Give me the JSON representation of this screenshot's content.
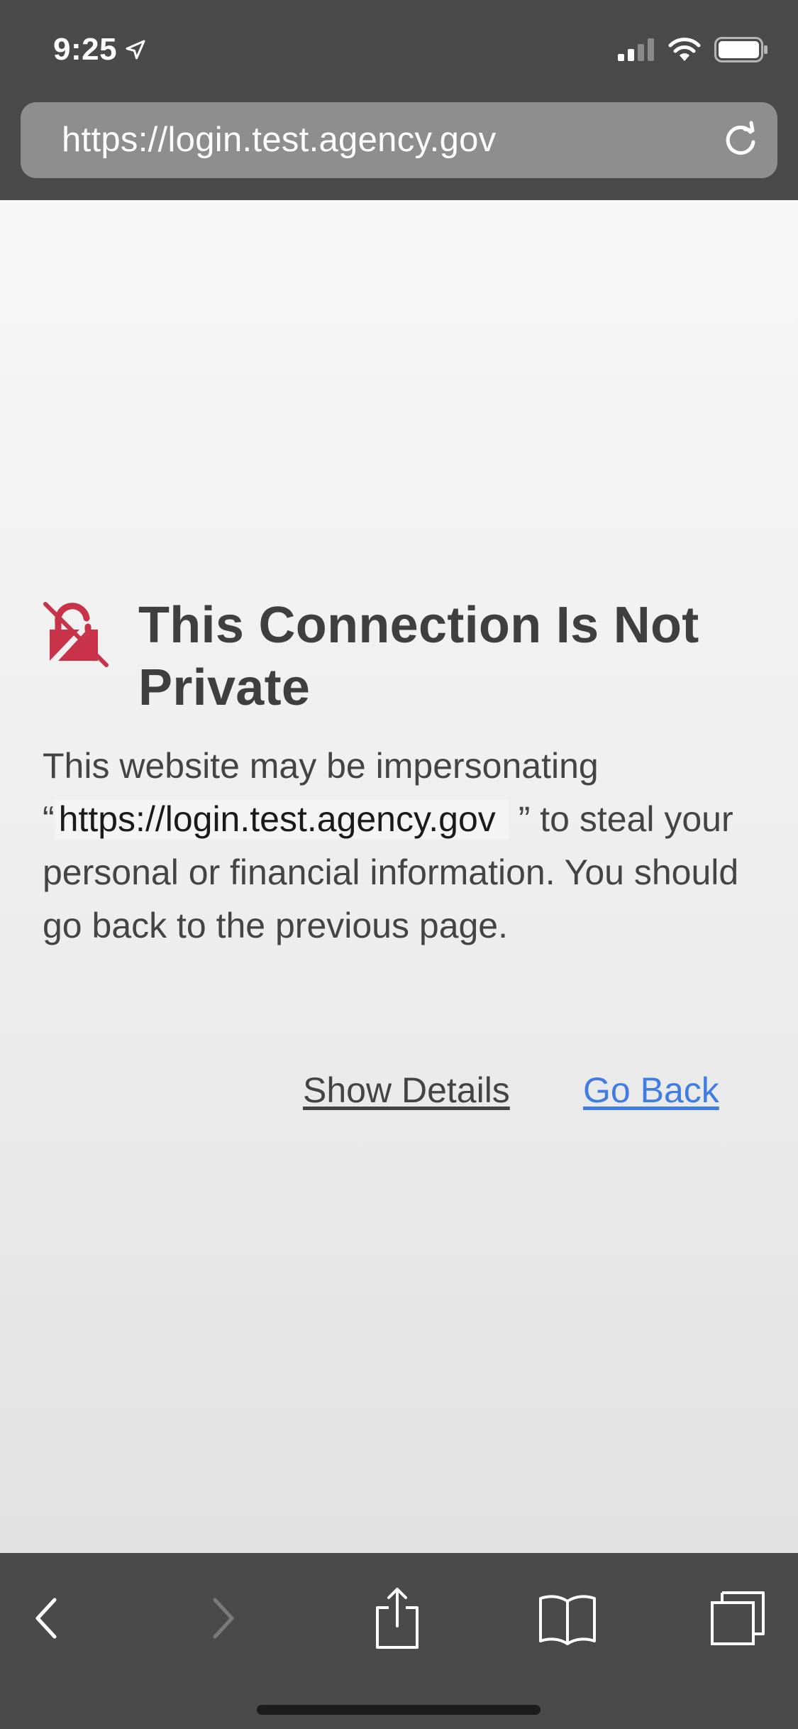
{
  "status_bar": {
    "time": "9:25",
    "location_icon": "location-arrow-icon",
    "signal_icon": "cellular-signal-icon",
    "wifi_icon": "wifi-icon",
    "battery_icon": "battery-icon"
  },
  "address_bar": {
    "url": "https://login.test.agency.gov",
    "reload_icon": "reload-icon"
  },
  "warning": {
    "icon": "broken-lock-icon",
    "icon_color": "#c8334a",
    "title": "This Connection Is Not Private",
    "body_prefix": "This website may be impersonating",
    "open_quote": "“",
    "domain": "https://login.test.agency.gov",
    "close_quote": "”",
    "body_suffix": "to steal your personal or financial information. You should go back to the previous page."
  },
  "actions": {
    "show_details": "Show Details",
    "go_back": "Go Back",
    "link_color": "#3f7de2"
  },
  "toolbar": {
    "back_icon": "chevron-left-icon",
    "forward_icon": "chevron-right-icon",
    "share_icon": "share-icon",
    "bookmarks_icon": "book-icon",
    "tabs_icon": "tabs-icon"
  }
}
